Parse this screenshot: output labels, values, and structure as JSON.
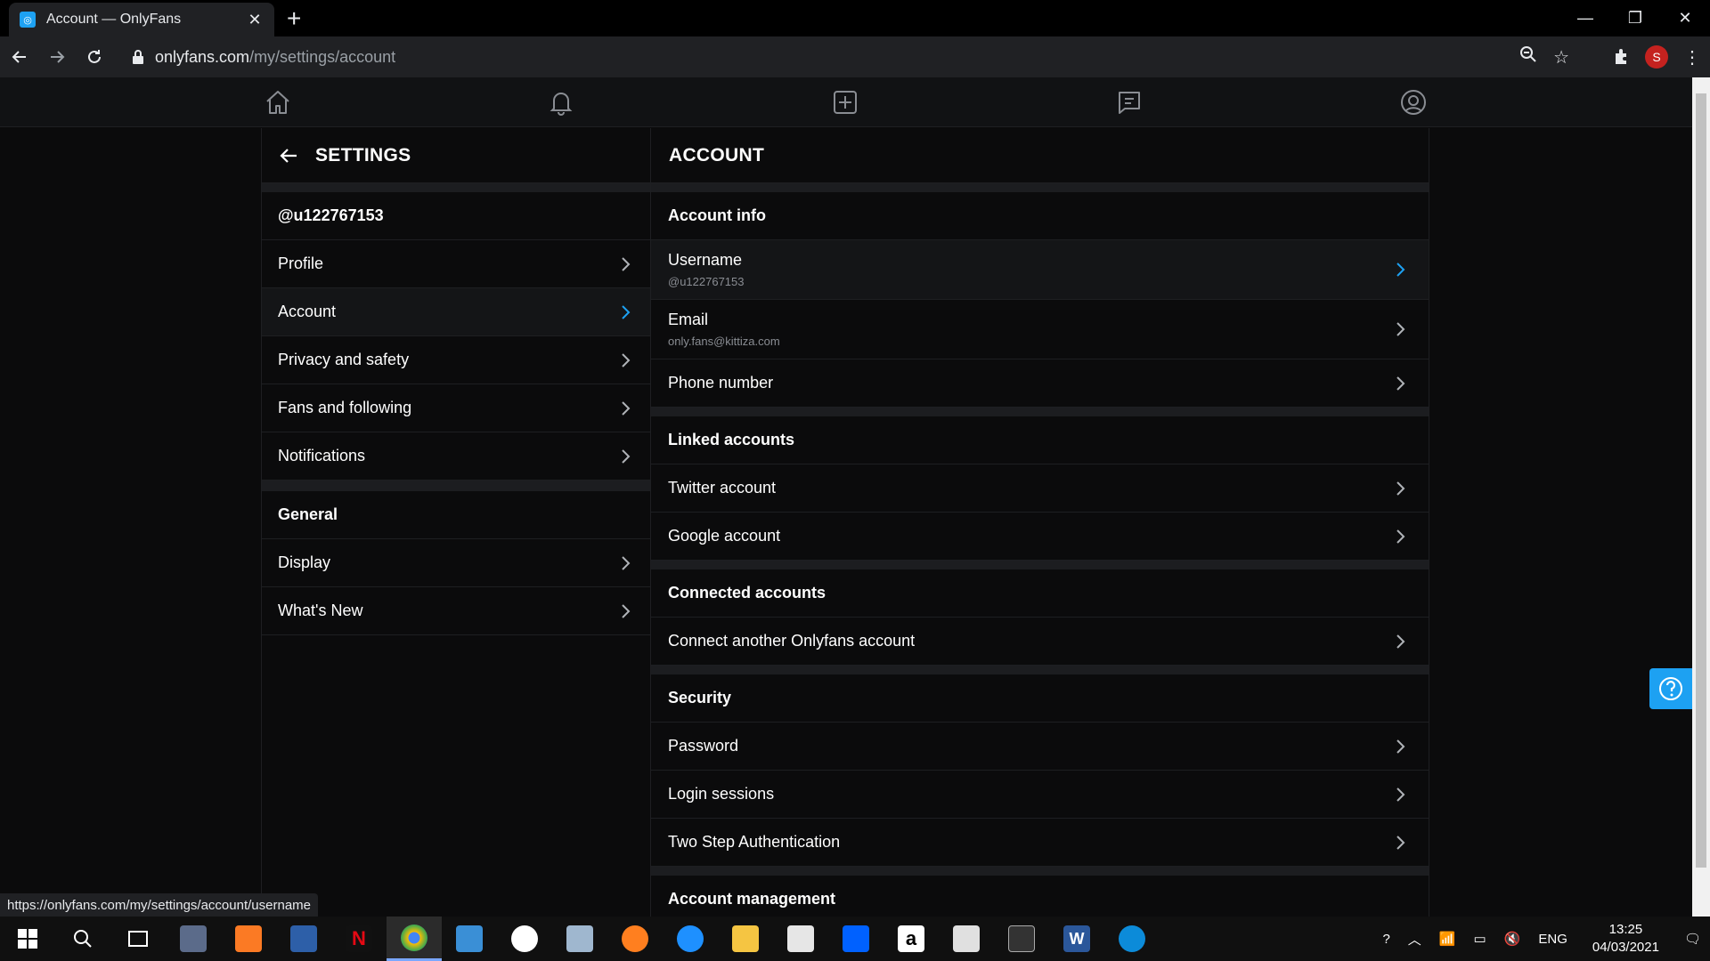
{
  "browser": {
    "tab_title": "Account — OnlyFans",
    "url_host": "onlyfans.com",
    "url_path": "/my/settings/account",
    "avatar_letter": "S",
    "status_url": "https://onlyfans.com/my/settings/account/username"
  },
  "settings": {
    "title": "SETTINGS",
    "handle": "@u122767153",
    "items": [
      {
        "label": "Profile"
      },
      {
        "label": "Account"
      },
      {
        "label": "Privacy and safety"
      },
      {
        "label": "Fans and following"
      },
      {
        "label": "Notifications"
      }
    ],
    "general_title": "General",
    "general_items": [
      {
        "label": "Display"
      },
      {
        "label": "What's New"
      }
    ]
  },
  "account": {
    "title": "ACCOUNT",
    "account_info": "Account info",
    "username_label": "Username",
    "username_value": "@u122767153",
    "email_label": "Email",
    "email_value": "only.fans@kittiza.com",
    "phone_label": "Phone number",
    "linked_title": "Linked accounts",
    "twitter": "Twitter account",
    "google": "Google account",
    "connected_title": "Connected accounts",
    "connect_another": "Connect another Onlyfans account",
    "security_title": "Security",
    "password": "Password",
    "login_sessions": "Login sessions",
    "two_step": "Two Step Authentication",
    "management_title": "Account management"
  },
  "taskbar": {
    "lang": "ENG",
    "time": "13:25",
    "date": "04/03/2021"
  },
  "colors": {
    "accent": "#1da1f2"
  }
}
